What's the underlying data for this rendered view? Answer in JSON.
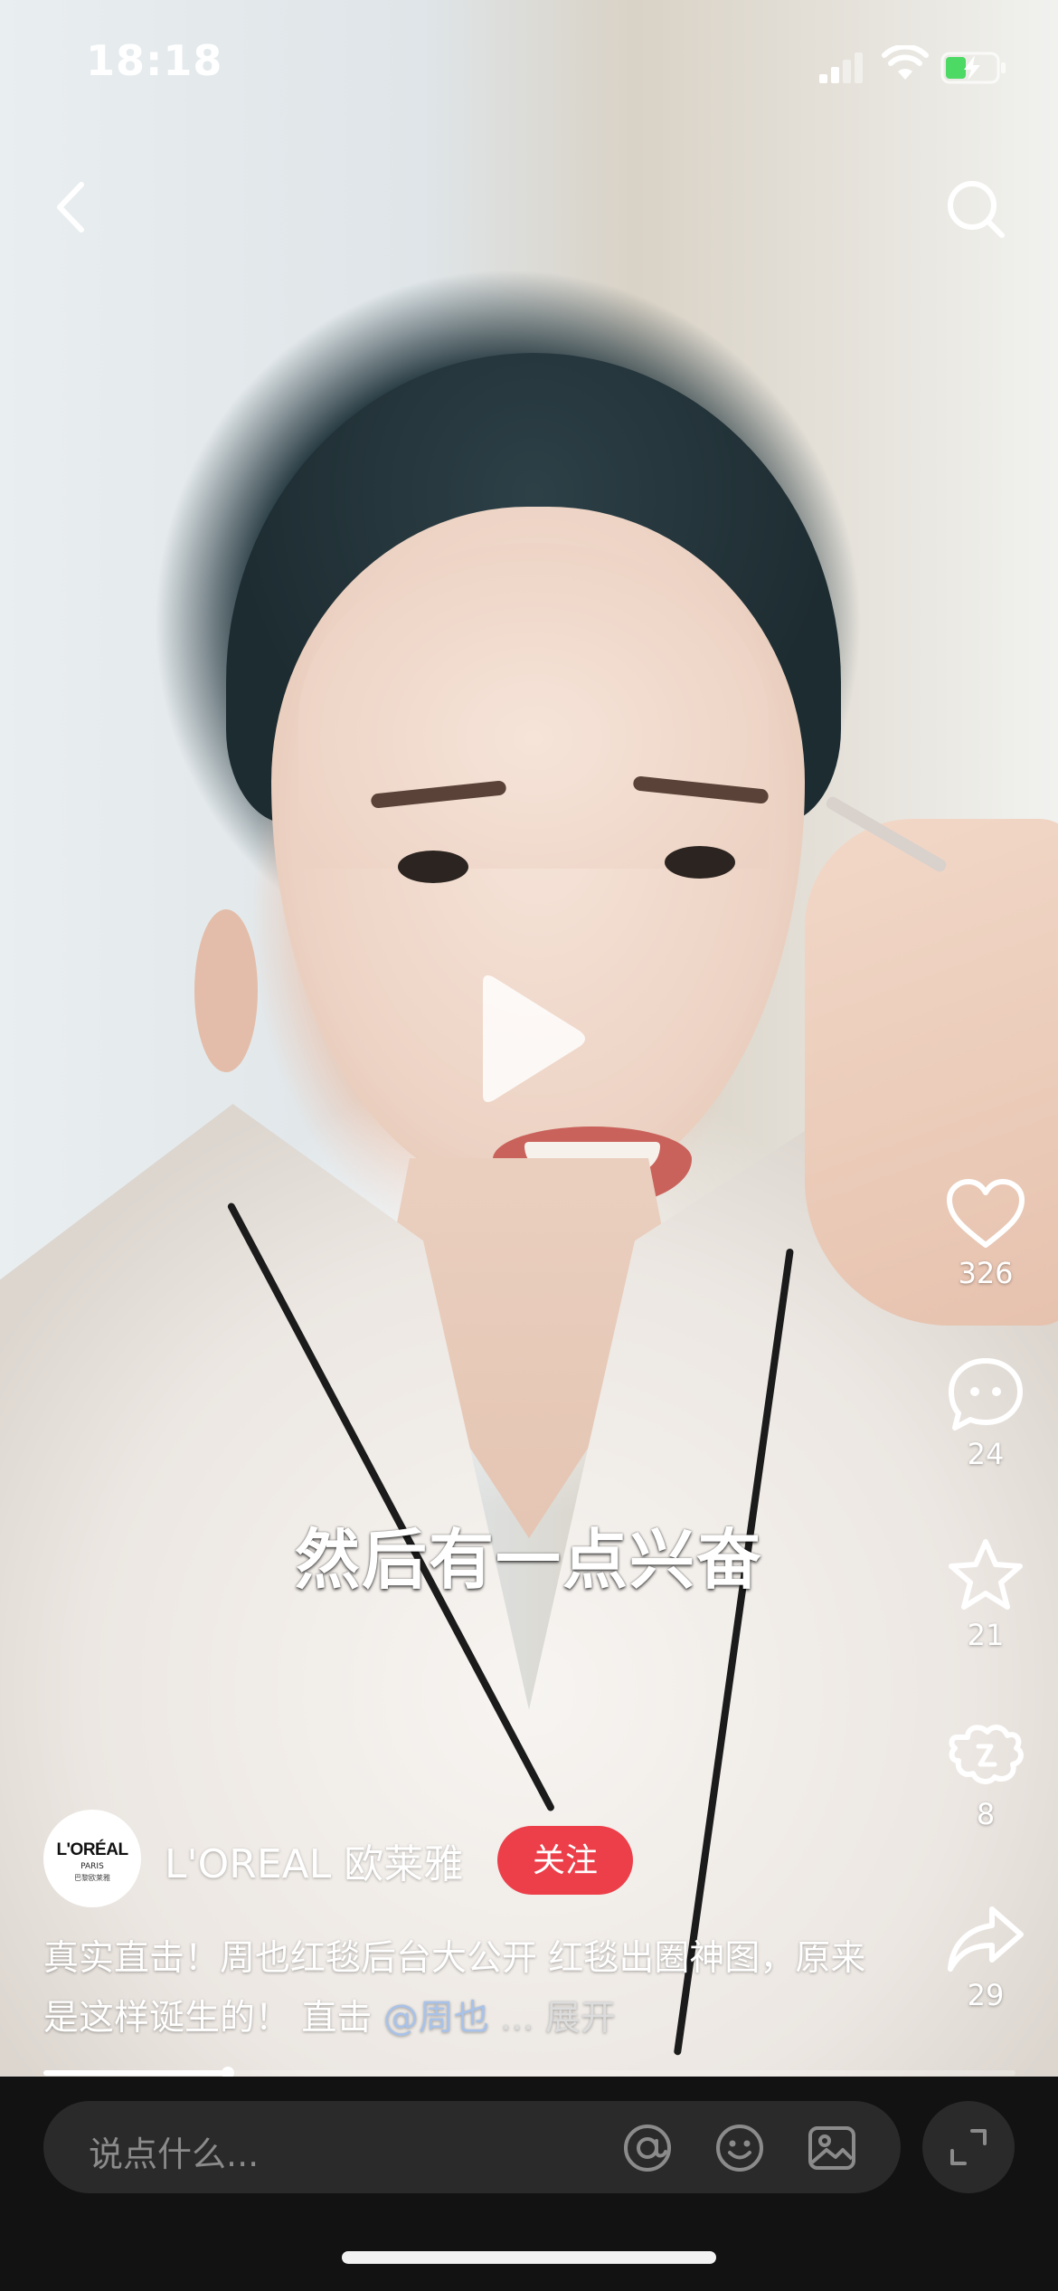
{
  "status_bar": {
    "time": "18:18"
  },
  "video": {
    "subtitle": "然后有一点兴奋",
    "progress": 0.19
  },
  "actions": {
    "like_count": "326",
    "comment_count": "24",
    "favorite_count": "21",
    "gift_count": "8",
    "share_count": "29"
  },
  "author": {
    "name": "L'OREAL 欧莱雅",
    "avatar_brand": "L'ORÉAL",
    "avatar_city": "PARIS",
    "avatar_cn": "巴黎欧莱雅",
    "follow_label": "关注"
  },
  "caption": {
    "text": "真实直击！周也红毯后台大公开 红毯出圈神图，原来是这样诞生的！ 直击",
    "mention": "@周也",
    "ellipsis": "...",
    "expand_label": "展开"
  },
  "comment_bar": {
    "placeholder": "说点什么..."
  },
  "colors": {
    "follow_button": "#ec3f4a",
    "mention": "#a9c2e8",
    "bottom_bar": "#121212"
  },
  "icons": [
    "back-icon",
    "search-icon",
    "play-icon",
    "heart-icon",
    "comment-icon",
    "star-icon",
    "gift-icon",
    "share-icon",
    "at-icon",
    "emoji-icon",
    "image-icon",
    "expand-icon"
  ]
}
